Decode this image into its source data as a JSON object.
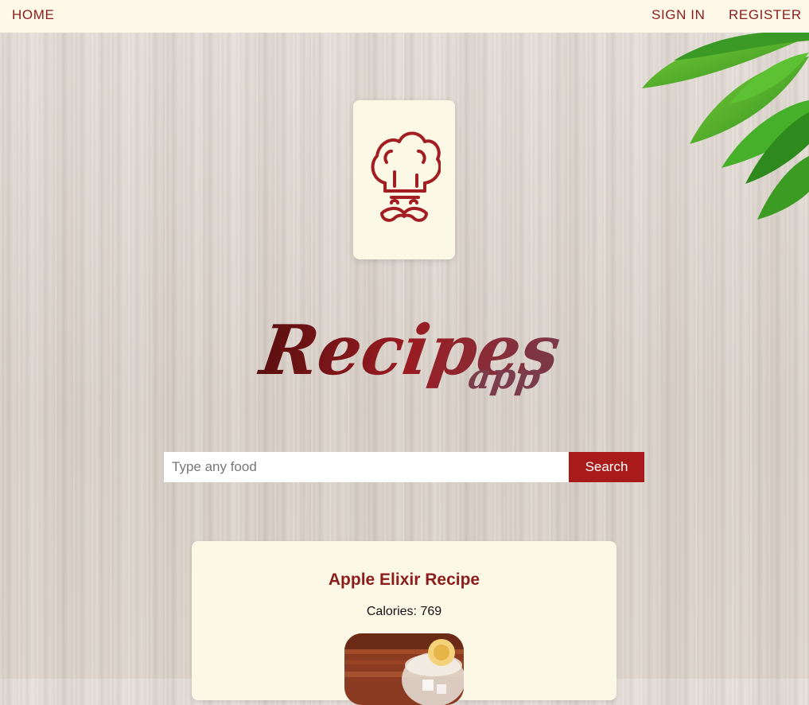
{
  "nav": {
    "home": "HOME",
    "sign_in": "SIGN IN",
    "register": "REGISTER"
  },
  "hero": {
    "logo_icon": "chef-hat-mustache-icon",
    "title_script": "Recipes",
    "title_sub": "app"
  },
  "search": {
    "placeholder": "Type any food",
    "value": "",
    "button_label": "Search"
  },
  "results": [
    {
      "title": "Apple Elixir Recipe",
      "calories": "Calories: 769",
      "image": "apple-elixir-drink-photo"
    }
  ],
  "colors": {
    "accent": "#8b1d1d",
    "button": "#a91b1b",
    "card_bg": "#fcf8e6",
    "nav_bg": "#fdf8e7"
  }
}
